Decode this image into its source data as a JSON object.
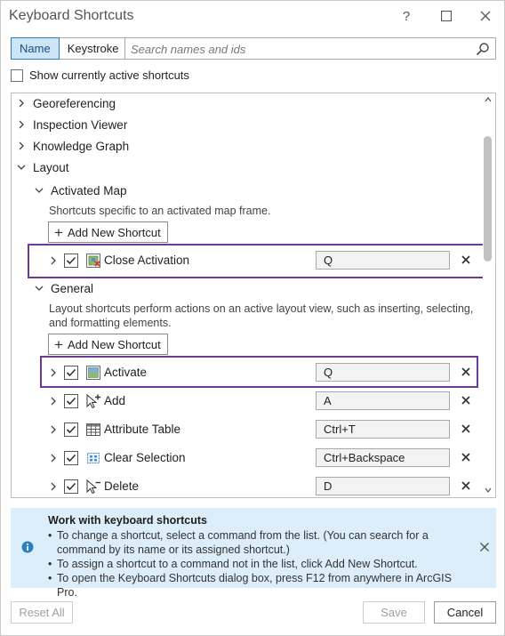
{
  "window": {
    "title": "Keyboard Shortcuts",
    "help_glyph": "?",
    "icons": [
      "help-icon",
      "maximize-icon",
      "close-icon"
    ]
  },
  "toolbar": {
    "tabs": [
      {
        "label": "Name",
        "active": true
      },
      {
        "label": "Keystroke",
        "active": false
      }
    ],
    "search_placeholder": "Search names and ids",
    "search_value": ""
  },
  "filter": {
    "show_active_label": "Show currently active shortcuts",
    "checked": false
  },
  "tree": {
    "collapsed_groups": [
      {
        "label": "Georeferencing"
      },
      {
        "label": "Inspection Viewer"
      },
      {
        "label": "Knowledge Graph"
      }
    ],
    "expanded_group": {
      "label": "Layout",
      "subgroups": [
        {
          "label": "Activated Map",
          "description": "Shortcuts specific to an activated map frame.",
          "add_label": "Add New Shortcut",
          "commands": [
            {
              "name": "Close Activation",
              "key": "Q",
              "checked": true,
              "icon": "close-activation-icon"
            }
          ]
        },
        {
          "label": "General",
          "description": "Layout shortcuts perform actions on an active layout view, such as inserting, selecting, and formatting elements.",
          "add_label": "Add New Shortcut",
          "commands": [
            {
              "name": "Activate",
              "key": "Q",
              "checked": true,
              "icon": "activate-map-icon"
            },
            {
              "name": "Add",
              "key": "A",
              "checked": true,
              "icon": "add-pointer-icon"
            },
            {
              "name": "Attribute Table",
              "key": "Ctrl+T",
              "checked": true,
              "icon": "table-icon"
            },
            {
              "name": "Clear Selection",
              "key": "Ctrl+Backspace",
              "checked": true,
              "icon": "clear-selection-icon"
            },
            {
              "name": "Delete",
              "key": "D",
              "checked": true,
              "icon": "delete-pointer-icon"
            }
          ]
        }
      ]
    }
  },
  "info": {
    "title": "Work with keyboard shortcuts",
    "bullets": [
      "To change a shortcut, select a command from the list. (You can search for a command by its name or its assigned shortcut.)",
      "To assign a shortcut to a command not in the list, click Add New Shortcut.",
      "To open the Keyboard Shortcuts dialog box, press F12 from anywhere in ArcGIS Pro."
    ]
  },
  "footer": {
    "reset_label": "Reset All",
    "save_label": "Save",
    "cancel_label": "Cancel"
  },
  "colors": {
    "accent": "#2e7fbe",
    "active_tab_bg": "#cde6f7",
    "highlight": "#6c3a95",
    "info_bg": "#dceefa"
  }
}
